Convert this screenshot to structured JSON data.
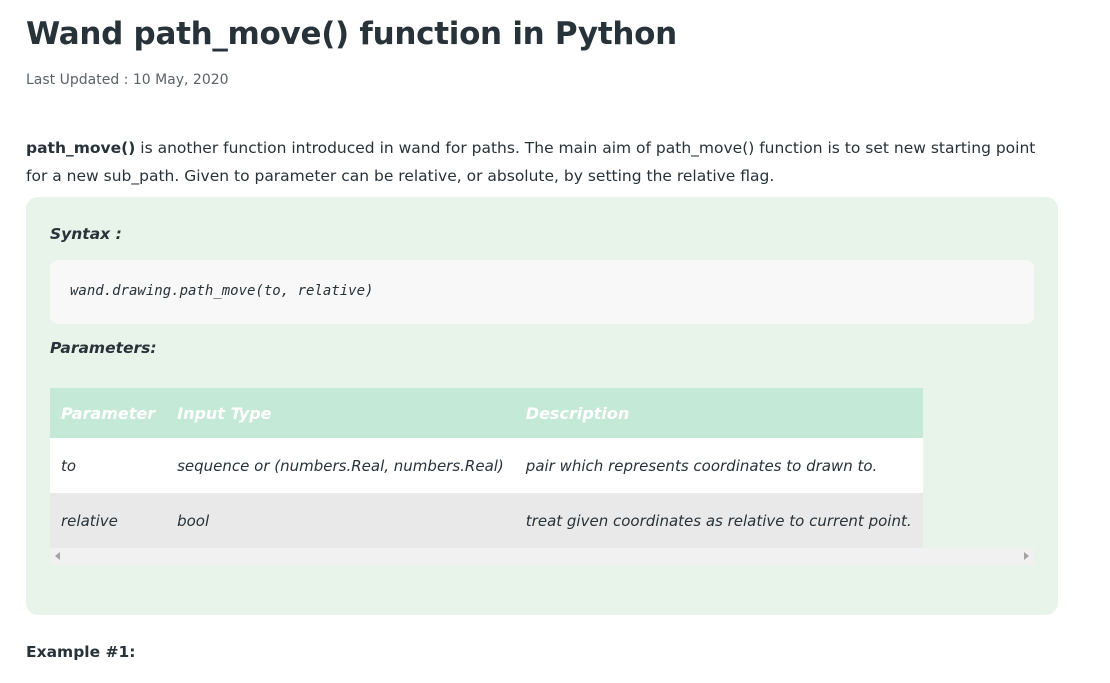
{
  "article": {
    "title": "Wand path_move() function in Python",
    "last_updated": "Last Updated : 10 May, 2020",
    "intro": {
      "function_name": "path_move()",
      "text": " is another function introduced in wand for paths. The main aim of path_move() function is to set new starting point for a new sub_path. Given to parameter can be relative, or absolute, by setting the relative flag."
    },
    "syntax_label": "Syntax :",
    "syntax_code": "wand.drawing.path_move(to, relative)",
    "parameters_label": "Parameters:",
    "parameters_table": {
      "headers": [
        "Parameter",
        "Input Type",
        "Description"
      ],
      "rows": [
        [
          "to",
          "sequence or (numbers.Real, numbers.Real)",
          "pair which represents coordinates to drawn to."
        ],
        [
          "relative",
          "bool",
          "treat given coordinates as relative to current point."
        ]
      ]
    },
    "example_label": "Example #1:"
  }
}
